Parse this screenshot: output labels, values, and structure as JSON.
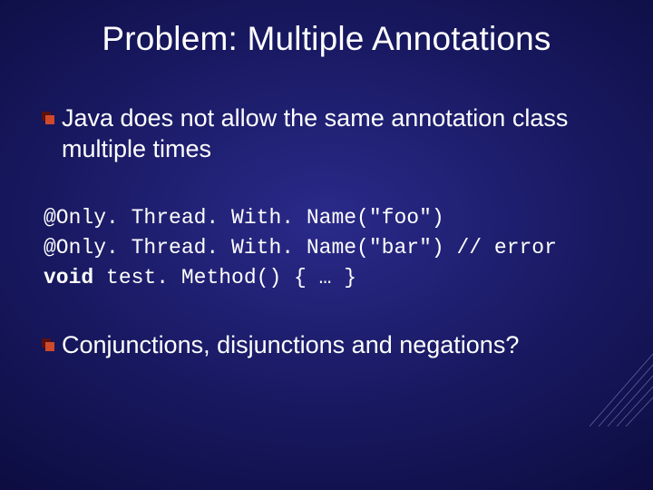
{
  "title": "Problem: Multiple Annotations",
  "bullets": {
    "b1": "Java does not allow the same annotation class multiple times",
    "b2": "Conjunctions, disjunctions and negations?"
  },
  "code": {
    "line1": "@Only. Thread. With. Name(\"foo\")",
    "line2_a": "@Only. Thread. With. Name(\"bar\") ",
    "line2_b": "// error",
    "line3_kw": "void",
    "line3_rest": " test. Method() { … }"
  }
}
